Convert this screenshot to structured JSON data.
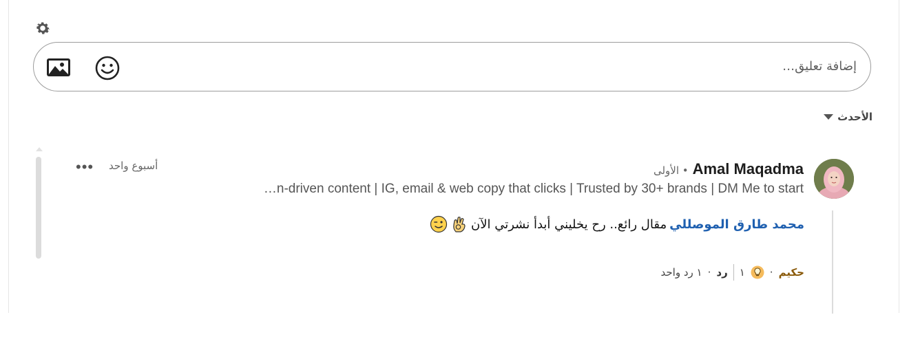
{
  "comments_section": {
    "settings_icon": "gear-icon",
    "composer": {
      "placeholder": "إضافة تعليق…",
      "image_icon": "image-icon",
      "emoji_icon": "smiley-icon"
    },
    "sort": {
      "label": "الأحدث",
      "icon": "caret-down-icon"
    },
    "comment": {
      "author_name": "Amal Maqadma",
      "degree": "• الأولى",
      "headline": "…n-driven content | IG, email & web copy that clicks | Trusted by 30+ brands | DM Me to start",
      "time": "أسبوع واحد",
      "more_label": "•••",
      "mention": "محمد طارق الموصللي",
      "text": "مقال رائع.. رح يخليني أبدأ نشرتي الآن",
      "emojis": [
        "ok-hand-icon",
        "wink-face-icon"
      ],
      "actions": {
        "react_label": "حكيم",
        "react_dot": "·",
        "react_count": "١",
        "reply_label": "رد",
        "reply_dot": "·",
        "reply_count": "١ رد واحد"
      }
    }
  },
  "colors": {
    "mention": "#1f60b0",
    "react": "#8a5a0a",
    "border": "#9c9c9c"
  }
}
